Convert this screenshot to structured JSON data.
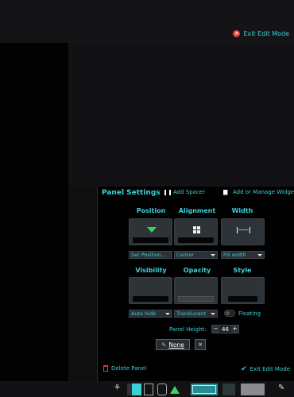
{
  "top": {
    "exit_label": "Exit Edit Mode"
  },
  "panel_settings": {
    "title": "Panel Settings",
    "add_spacer": "Add Spacer",
    "add_widgets": "Add or Manage Widgets...",
    "columns": {
      "position": "Position",
      "alignment": "Alignment",
      "width": "Width",
      "visibility": "Visibility",
      "opacity": "Opacity",
      "style": "Style"
    },
    "dropdowns": {
      "position": "Set Position...",
      "alignment": "Center",
      "width": "Fill width",
      "visibility": "Auto hide",
      "opacity": "Translucent"
    },
    "floating_label": "Floating",
    "panel_height_label": "Panel Height:",
    "panel_height_value": "46",
    "none_button": "None",
    "close_small": "×",
    "delete_label": "Delete Panel",
    "exit_label": "Exit Edit Mode"
  },
  "colors": {
    "accent": "#3fd0d6",
    "danger": "#e03c3c",
    "green": "#3cd25a"
  }
}
